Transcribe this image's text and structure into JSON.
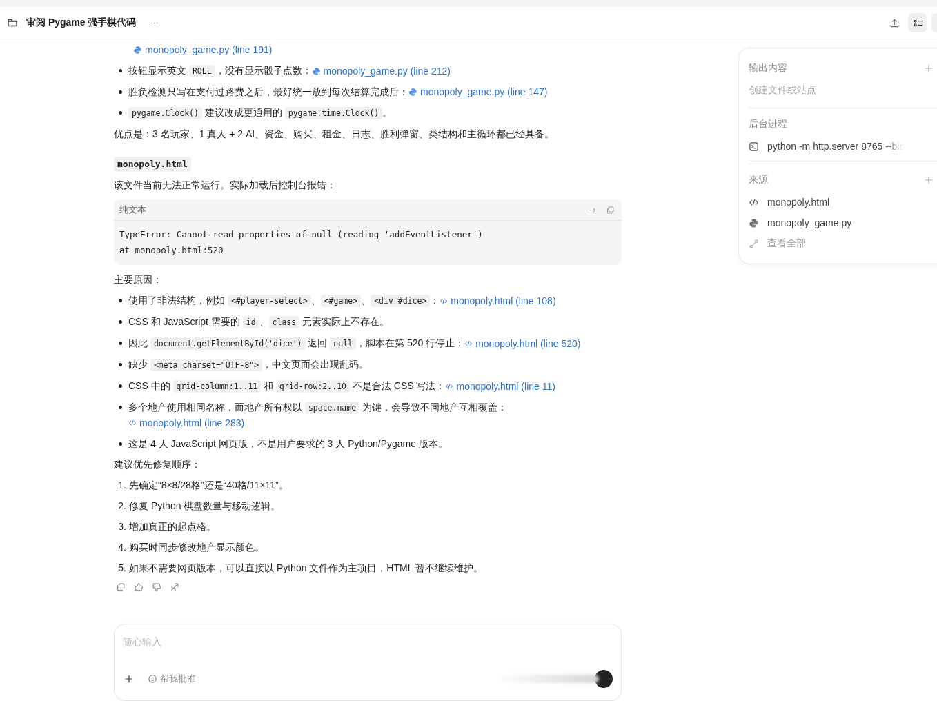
{
  "header": {
    "title": "审阅 Pygame 强手棋代码",
    "toolbar": [
      {
        "kind": "upload",
        "selected": false
      },
      {
        "kind": "panel",
        "selected": true
      }
    ]
  },
  "message": {
    "blocks": [
      {
        "kind": "continuation",
        "segments": [
          {
            "kind": "py-link",
            "text": "monopoly_game.py (line 191)"
          }
        ]
      },
      {
        "kind": "bullets",
        "items": [
          [
            {
              "kind": "text",
              "text": "按钮显示英文 "
            },
            {
              "kind": "code",
              "text": "ROLL"
            },
            {
              "kind": "text",
              "text": "，没有显示骰子点数："
            },
            {
              "kind": "py-link",
              "text": "monopoly_game.py (line 212)"
            }
          ],
          [
            {
              "kind": "text",
              "text": "胜负检测只写在支付过路费之后，最好统一放到每次结算完成后："
            },
            {
              "kind": "py-link",
              "text": "monopoly_game.py (line 147)"
            }
          ],
          [
            {
              "kind": "code",
              "text": "pygame.Clock()"
            },
            {
              "kind": "text",
              "text": " 建议改成更通用的 "
            },
            {
              "kind": "code",
              "text": "pygame.time.Clock()"
            },
            {
              "kind": "text",
              "text": "。"
            }
          ]
        ]
      },
      {
        "kind": "paragraph",
        "text": "优点是：3 名玩家、1 真人 + 2 AI、资金、购买、租金、日志、胜利弹窗、类结构和主循环都已经具备。"
      },
      {
        "kind": "heading",
        "text": "monopoly.html"
      },
      {
        "kind": "paragraph",
        "text": "该文件当前无法正常运行。实际加载后控制台报错："
      },
      {
        "kind": "codeblock",
        "language": "纯文本",
        "lines": [
          "TypeError: Cannot read properties of null (reading 'addEventListener')",
          "at monopoly.html:520"
        ]
      },
      {
        "kind": "paragraph",
        "text": "主要原因："
      },
      {
        "kind": "bullets",
        "items": [
          [
            {
              "kind": "text",
              "text": "使用了非法结构，例如 "
            },
            {
              "kind": "code",
              "text": "<#player-select>"
            },
            {
              "kind": "text",
              "text": "、"
            },
            {
              "kind": "code",
              "text": "<#game>"
            },
            {
              "kind": "text",
              "text": "、"
            },
            {
              "kind": "code",
              "text": "<div #dice>"
            },
            {
              "kind": "text",
              "text": "："
            },
            {
              "kind": "html-link",
              "text": "monopoly.html (line 108)"
            }
          ],
          [
            {
              "kind": "text",
              "text": "CSS 和 JavaScript 需要的 "
            },
            {
              "kind": "code",
              "text": "id"
            },
            {
              "kind": "text",
              "text": "、"
            },
            {
              "kind": "code",
              "text": "class"
            },
            {
              "kind": "text",
              "text": " 元素实际上不存在。"
            }
          ],
          [
            {
              "kind": "text",
              "text": "因此 "
            },
            {
              "kind": "code",
              "text": "document.getElementById('dice')"
            },
            {
              "kind": "text",
              "text": " 返回 "
            },
            {
              "kind": "code",
              "text": "null"
            },
            {
              "kind": "text",
              "text": "，脚本在第 520 行停止："
            },
            {
              "kind": "html-link",
              "text": "monopoly.html (line 520)"
            }
          ],
          [
            {
              "kind": "text",
              "text": "缺少 "
            },
            {
              "kind": "code",
              "text": "<meta charset=\"UTF-8\">"
            },
            {
              "kind": "text",
              "text": "，中文页面会出现乱码。"
            }
          ],
          [
            {
              "kind": "text",
              "text": "CSS 中的 "
            },
            {
              "kind": "code",
              "text": "grid-column:1..11"
            },
            {
              "kind": "text",
              "text": " 和 "
            },
            {
              "kind": "code",
              "text": "grid-row:2..10"
            },
            {
              "kind": "text",
              "text": " 不是合法 CSS 写法："
            },
            {
              "kind": "html-link",
              "text": "monopoly.html (line 11)"
            }
          ],
          [
            {
              "kind": "text",
              "text": "多个地产使用相同名称，而地产所有权以 "
            },
            {
              "kind": "code",
              "text": "space.name"
            },
            {
              "kind": "text",
              "text": " 为键，会导致不同地产互相覆盖："
            },
            {
              "kind": "html-link",
              "text": "monopoly.html (line 283)"
            }
          ],
          [
            {
              "kind": "text",
              "text": "这是 4 人 JavaScript 网页版，不是用户要求的 3 人 Python/Pygame 版本。"
            }
          ]
        ]
      },
      {
        "kind": "paragraph",
        "text": "建议优先修复顺序："
      },
      {
        "kind": "numbered",
        "items": [
          {
            "number": "1.",
            "text": "先确定“8×8/28格”还是“40格/11×11”。"
          },
          {
            "number": "2.",
            "text": "修复 Python 棋盘数量与移动逻辑。"
          },
          {
            "number": "3.",
            "text": "增加真正的起点格。"
          },
          {
            "number": "4.",
            "text": "购买时同步修改地产显示颜色。"
          },
          {
            "number": "5.",
            "text": "如果不需要网页版本，可以直接以 Python 文件作为主项目，HTML 暂不继续维护。"
          }
        ]
      }
    ]
  },
  "composer": {
    "placeholder": "随心输入",
    "approve_label": "帮我批准"
  },
  "side_panel": {
    "sections": [
      {
        "title": "输出内容",
        "add": true,
        "items": [
          {
            "kind": "hint",
            "text": "创建文件或站点"
          }
        ]
      },
      {
        "title": "后台进程",
        "add": false,
        "items": [
          {
            "kind": "terminal",
            "text": "python -m http.server 8765 --bin"
          }
        ]
      },
      {
        "title": "来源",
        "add": true,
        "items": [
          {
            "kind": "html",
            "text": "monopoly.html"
          },
          {
            "kind": "python",
            "text": "monopoly_game.py"
          },
          {
            "kind": "all",
            "text": "查看全部"
          }
        ]
      }
    ]
  }
}
